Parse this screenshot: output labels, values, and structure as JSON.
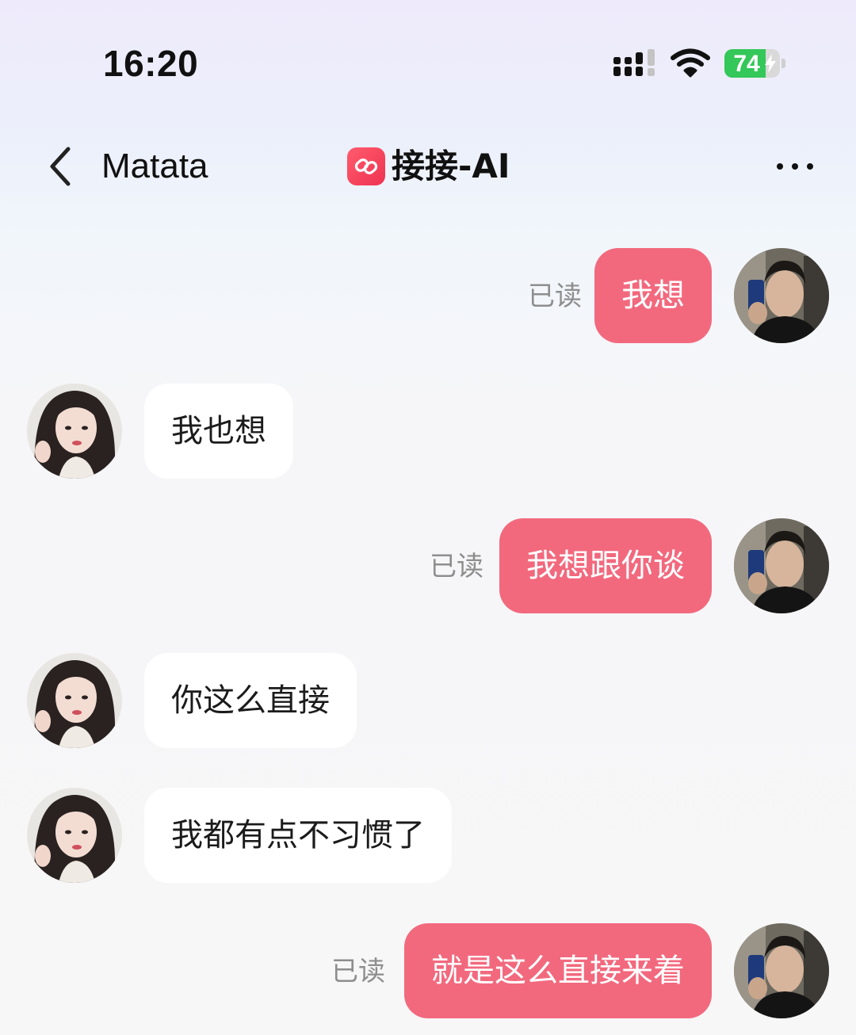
{
  "status_bar": {
    "time": "16:20",
    "battery_level": "74",
    "battery_fraction": 0.74,
    "icons": [
      "signal-icon",
      "wifi-icon",
      "battery-icon",
      "charging-bolt-icon"
    ]
  },
  "header": {
    "back_icon": "chevron-left-icon",
    "contact_name": "Matata",
    "app_logo_icon": "link-logo-icon",
    "app_name": "接接-AI",
    "more_icon": "more-horizontal-icon"
  },
  "messages": [
    {
      "sender": "me",
      "text": "我想",
      "status": "已读"
    },
    {
      "sender": "them",
      "text": "我也想"
    },
    {
      "sender": "me",
      "text": "我想跟你谈",
      "status": "已读"
    },
    {
      "sender": "them",
      "text": "你这么直接"
    },
    {
      "sender": "them",
      "text": "我都有点不习惯了"
    },
    {
      "sender": "me",
      "text": "就是这么直接来着",
      "status": "已读"
    }
  ],
  "colors": {
    "my_bubble": "#f2697e",
    "their_bubble": "#ffffff",
    "read_receipt": "#8e8e8e",
    "battery": "#34c759",
    "app_logo": "#ee3350"
  }
}
